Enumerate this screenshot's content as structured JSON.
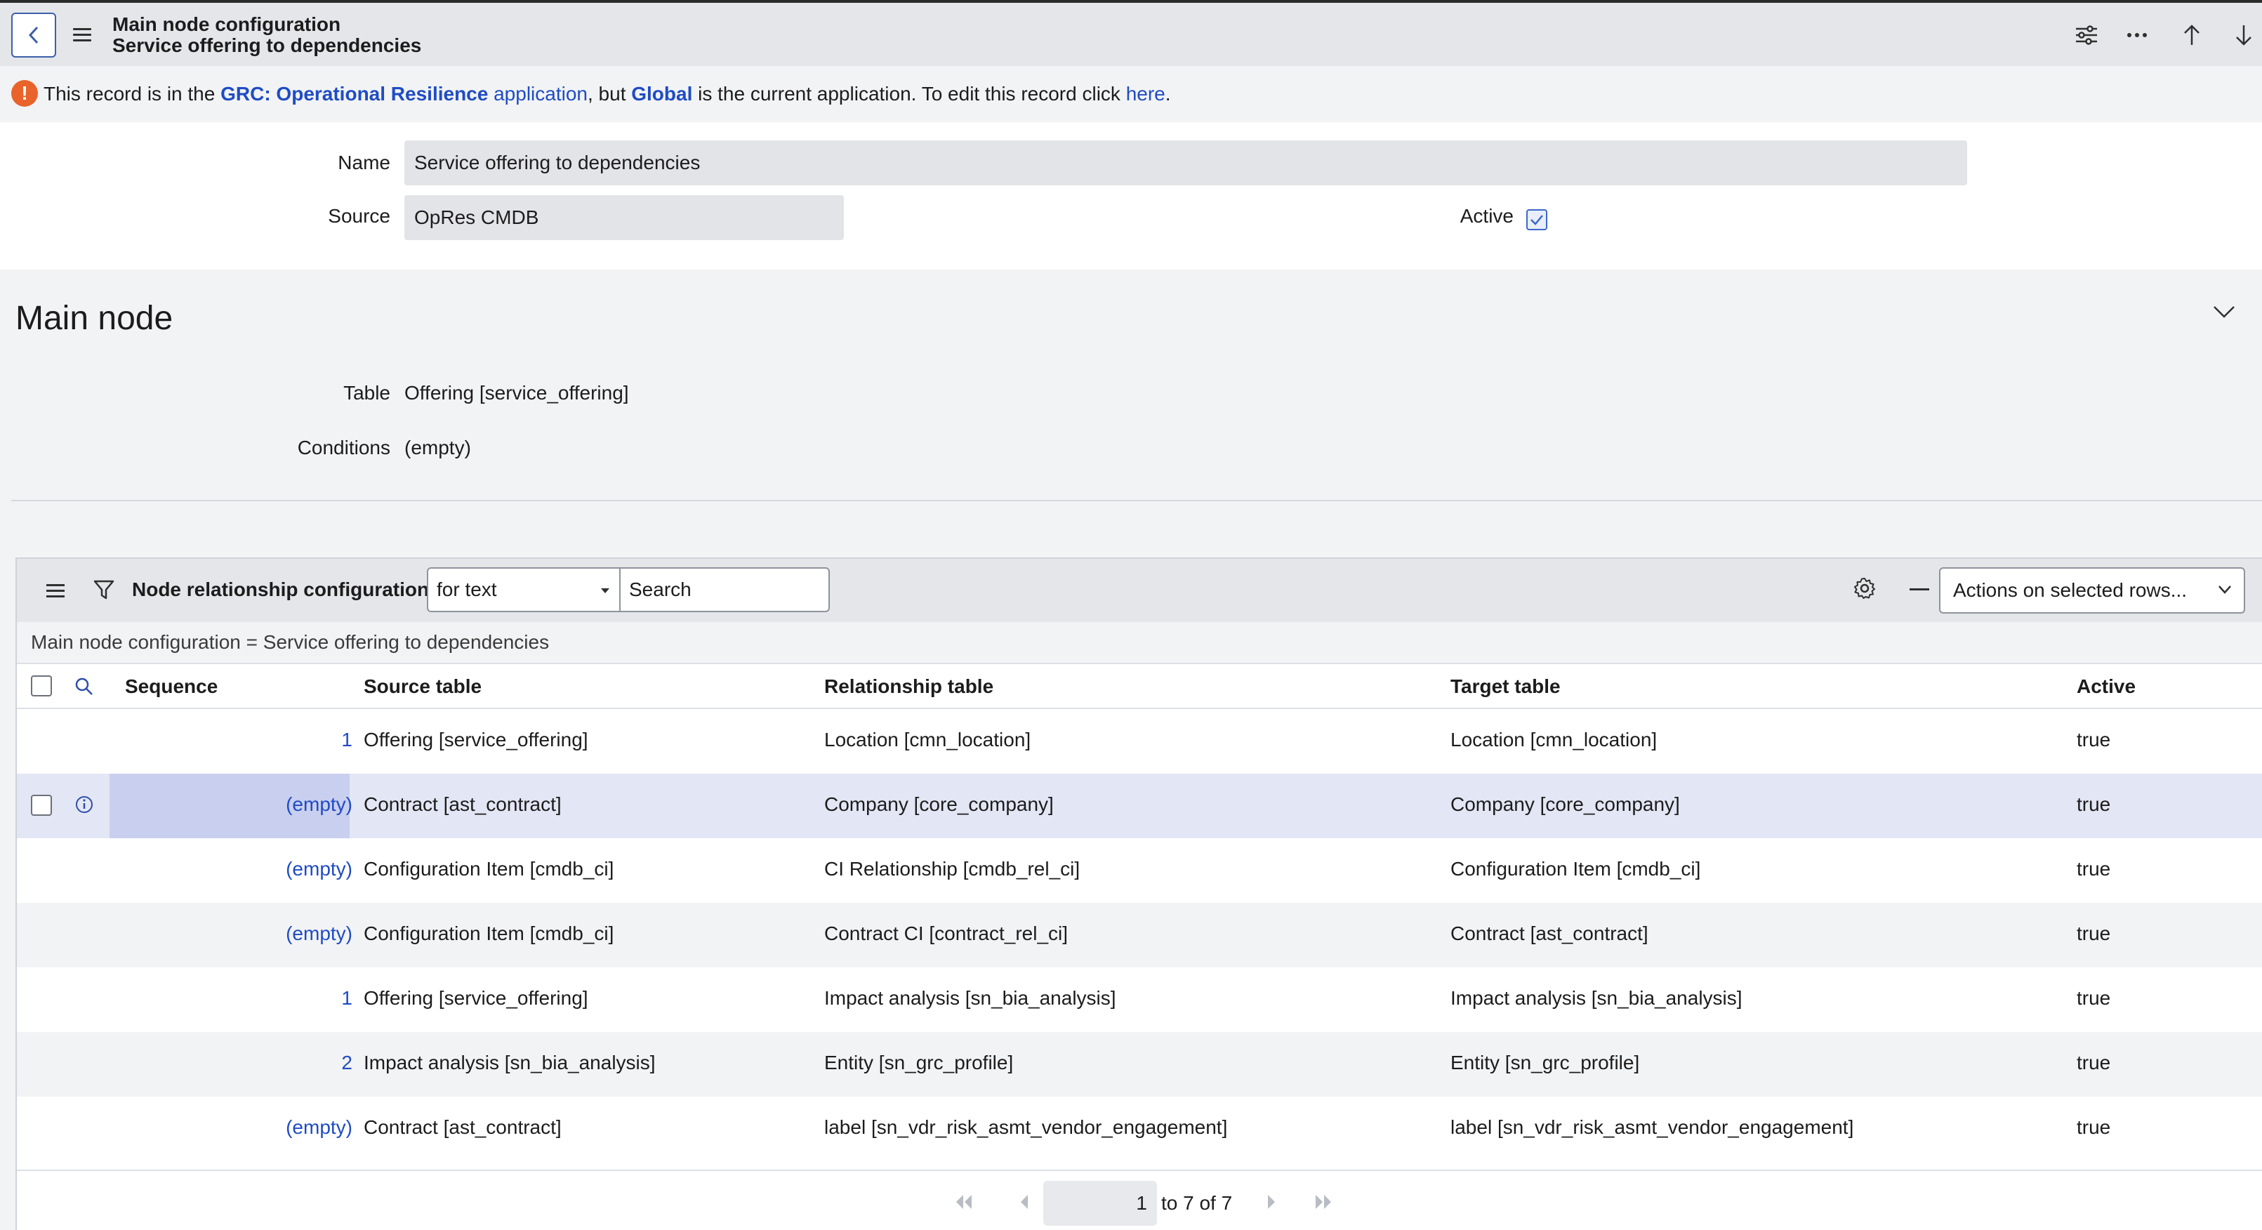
{
  "header": {
    "title": "Main node configuration",
    "subtitle": "Service offering to dependencies"
  },
  "banner": {
    "prefix": "This record is in the ",
    "app_link": "GRC: Operational Resilience",
    "app_word": " application",
    "middle": ", but ",
    "current_app": "Global",
    "suffix": " is the current application. To edit this record click ",
    "here_link": "here",
    "end": "."
  },
  "form": {
    "name_label": "Name",
    "name_value": "Service offering to dependencies",
    "source_label": "Source",
    "source_value": "OpRes CMDB",
    "active_label": "Active",
    "active_checked": true
  },
  "main_node": {
    "title": "Main node",
    "table_label": "Table",
    "table_value": "Offering [service_offering]",
    "conditions_label": "Conditions",
    "conditions_value": "(empty)"
  },
  "related_list": {
    "title": "Node relationship configurations",
    "search_field": "for text",
    "search_placeholder": "Search",
    "actions_label": "Actions on selected rows...",
    "breadcrumb": "Main node configuration = Service offering to dependencies",
    "columns": [
      "Sequence",
      "Source table",
      "Relationship table",
      "Target table",
      "Active"
    ],
    "rows": [
      {
        "sequence": "1",
        "source": "Offering [service_offering]",
        "relationship": "Location [cmn_location]",
        "target": "Location [cmn_location]",
        "active": "true"
      },
      {
        "sequence": "(empty)",
        "source": "Contract [ast_contract]",
        "relationship": "Company [core_company]",
        "target": "Company [core_company]",
        "active": "true"
      },
      {
        "sequence": "(empty)",
        "source": "Configuration Item [cmdb_ci]",
        "relationship": "CI Relationship [cmdb_rel_ci]",
        "target": "Configuration Item [cmdb_ci]",
        "active": "true"
      },
      {
        "sequence": "(empty)",
        "source": "Configuration Item [cmdb_ci]",
        "relationship": "Contract CI [contract_rel_ci]",
        "target": "Contract [ast_contract]",
        "active": "true"
      },
      {
        "sequence": "1",
        "source": "Offering [service_offering]",
        "relationship": "Impact analysis [sn_bia_analysis]",
        "target": "Impact analysis [sn_bia_analysis]",
        "active": "true"
      },
      {
        "sequence": "2",
        "source": "Impact analysis [sn_bia_analysis]",
        "relationship": "Entity [sn_grc_profile]",
        "target": "Entity [sn_grc_profile]",
        "active": "true"
      },
      {
        "sequence": "(empty)",
        "source": "Contract [ast_contract]",
        "relationship": "label [sn_vdr_risk_asmt_vendor_engagement]",
        "target": "label [sn_vdr_risk_asmt_vendor_engagement]",
        "active": "true"
      }
    ],
    "pager": {
      "page": "1",
      "range_text": "to 7 of 7"
    }
  },
  "colors": {
    "link": "#1f4cc4",
    "warning": "#e8642a",
    "header_bg": "#e4e6ea",
    "section_bg": "#f2f3f5",
    "row_highlight": "#e3e6f4"
  }
}
